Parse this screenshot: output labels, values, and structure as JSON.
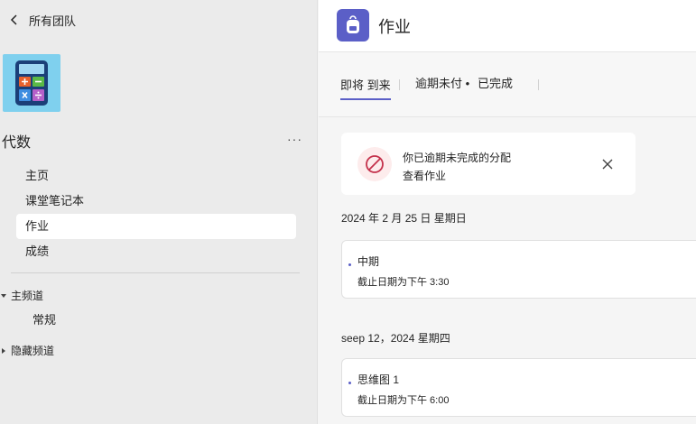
{
  "sidebar": {
    "back_label": "所有团队",
    "team_name": "代数",
    "more_label": "···",
    "nav_items": [
      {
        "label": "主页"
      },
      {
        "label": "课堂笔记本"
      },
      {
        "label": "作业"
      },
      {
        "label": "成绩"
      }
    ],
    "active_nav": "作业",
    "sections": {
      "main_channels": "主频道",
      "hidden_channels": "隐藏频道"
    },
    "channels": [
      {
        "label": "常规"
      }
    ]
  },
  "main": {
    "app_title": "作业",
    "tabs": [
      {
        "label": "即将 到来"
      },
      {
        "label": "逾期未付 •"
      },
      {
        "label": "已完成"
      }
    ],
    "banner": {
      "title": "你已逾期未完成的分配",
      "link": "查看作业"
    },
    "groups": [
      {
        "date": "2024 年 2 月 25 日   星期日",
        "items": [
          {
            "title": "中期",
            "due": "截止日期为下午 3:30"
          }
        ]
      },
      {
        "date": "seep 12，2024   星期四",
        "items": [
          {
            "title": "思维图 1",
            "due": "截止日期为下午 6:00"
          }
        ]
      }
    ]
  },
  "colors": {
    "accent": "#5b5fc7",
    "sidebar_bg": "#ebebeb",
    "team_logo_bg": "#7fd0ee",
    "warning": "#c4314b"
  },
  "icons": {
    "back": "chevron-left-icon",
    "team_logo": "calculator-icon",
    "app": "backpack-icon",
    "banner": "prohibited-icon",
    "close": "close-icon"
  }
}
